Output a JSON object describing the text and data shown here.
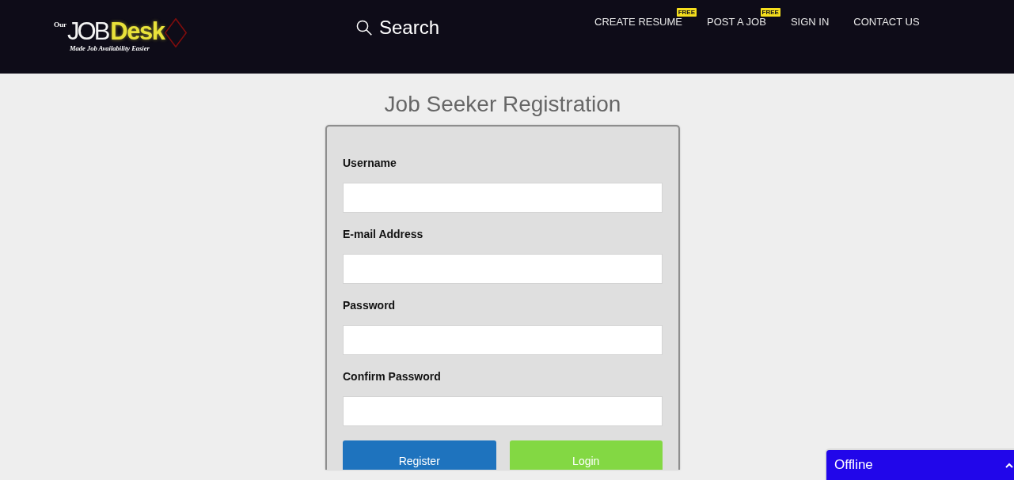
{
  "header": {
    "logo": {
      "prefix": "Our",
      "name_first": "JOB",
      "name_second": "Desk",
      "tagline": "Made Job Availability Easier"
    },
    "search": {
      "label": "Search"
    },
    "nav": [
      {
        "label": "CREATE RESUME",
        "badge": "FREE"
      },
      {
        "label": "POST A JOB",
        "badge": "FREE"
      },
      {
        "label": "SIGN IN"
      },
      {
        "label": "CONTACT US"
      }
    ]
  },
  "form": {
    "title": "Job Seeker Registration",
    "fields": [
      {
        "label": "Username"
      },
      {
        "label": "E-mail Address"
      },
      {
        "label": "Password"
      },
      {
        "label": "Confirm Password"
      }
    ],
    "buttons": [
      {
        "label": "Register",
        "kind": "primary"
      },
      {
        "label": "Login",
        "kind": "secondary"
      }
    ]
  },
  "chat": {
    "status": "Offline",
    "expanded": false
  }
}
